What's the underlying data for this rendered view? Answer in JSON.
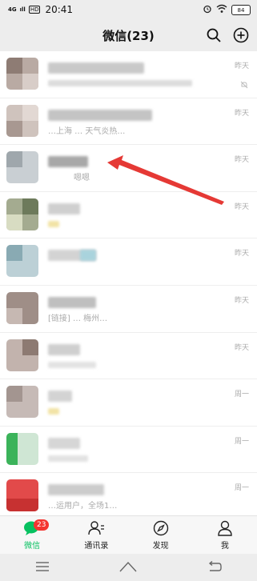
{
  "status": {
    "network": "4G",
    "signal_tiny": "ıll",
    "hd": "HD",
    "time": "20:41",
    "battery": "84"
  },
  "header": {
    "title": "微信(23)"
  },
  "chats": [
    {
      "time": "昨天",
      "preview": "",
      "muted": true
    },
    {
      "time": "昨天",
      "preview": "…上海 … 天气炎热…"
    },
    {
      "time": "昨天",
      "preview": "嗯嗯"
    },
    {
      "time": "昨天",
      "preview": ""
    },
    {
      "time": "昨天",
      "preview": ""
    },
    {
      "time": "昨天",
      "preview": "[链接] … 梅州…"
    },
    {
      "time": "昨天",
      "preview": ""
    },
    {
      "time": "周一",
      "preview": ""
    },
    {
      "time": "周一",
      "preview": ""
    },
    {
      "time": "周一",
      "preview": "…运用户，全场1…"
    }
  ],
  "tabs": [
    {
      "label": "微信",
      "badge": "23"
    },
    {
      "label": "通讯录"
    },
    {
      "label": "发现"
    },
    {
      "label": "我"
    }
  ],
  "colors": {
    "accent": "#07c160",
    "badge": "#f43530",
    "arrow": "#e53935"
  }
}
